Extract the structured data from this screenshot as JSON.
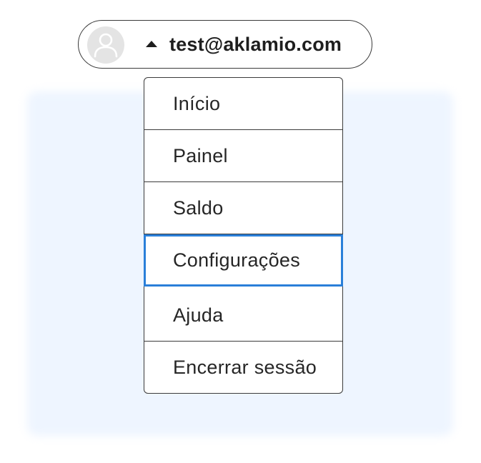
{
  "account": {
    "email": "test@aklamio.com",
    "caret_icon": "caret-up-icon",
    "avatar_icon": "user-avatar-icon",
    "expanded": true
  },
  "menu": {
    "items": [
      {
        "label": "Início",
        "focused": false
      },
      {
        "label": "Painel",
        "focused": false
      },
      {
        "label": "Saldo",
        "focused": false
      },
      {
        "label": "Configurações",
        "focused": true
      },
      {
        "label": "Ajuda",
        "focused": false
      },
      {
        "label": "Encerrar sessão",
        "focused": false
      }
    ]
  },
  "colors": {
    "focus_outline": "#2a7fd9",
    "backdrop": "#eef5ff",
    "text": "#262626",
    "border": "#3a3a3a",
    "avatar_bg": "#e4e4e4"
  }
}
